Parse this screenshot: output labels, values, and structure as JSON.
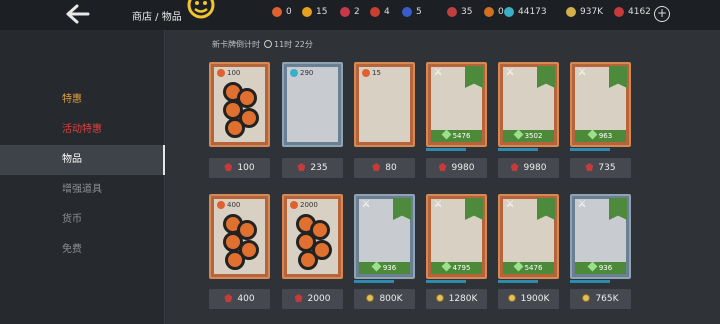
{
  "header": {
    "breadcrumb": "商店 / 物品"
  },
  "resources": [
    {
      "value": "0",
      "color": "#e06030"
    },
    {
      "value": "15",
      "color": "#e8a020"
    },
    {
      "value": "2",
      "color": "#c83848"
    },
    {
      "value": "4",
      "color": "#c84030"
    },
    {
      "value": "5",
      "color": "#3a5cc8"
    },
    {
      "value": "35",
      "color": "#c04040"
    },
    {
      "value": "0",
      "color": "#d07020"
    },
    {
      "value": "44173",
      "color": "#3ab0c8"
    },
    {
      "value": "937K",
      "color": "#d4b04a"
    },
    {
      "value": "4162",
      "color": "#c53a3a"
    }
  ],
  "sidebar": {
    "items": [
      "特惠",
      "活动特惠",
      "物品",
      "增强道具",
      "货币",
      "免费"
    ],
    "colors": [
      "#e0a040",
      "#e04040",
      "#ffffff",
      "#8c8f93",
      "#8c8f93",
      "#8c8f93"
    ]
  },
  "timer": {
    "label": "新卡牌倒计时",
    "value": "11时 22分"
  },
  "row1": [
    {
      "count": "100",
      "price": "100",
      "currency": "ruby",
      "type": "orange"
    },
    {
      "count": "290",
      "price": "235",
      "currency": "ruby",
      "type": "blue"
    },
    {
      "count": "15",
      "price": "80",
      "currency": "ruby",
      "type": "orange"
    },
    {
      "band": "5476",
      "price": "9980",
      "currency": "ruby",
      "type": "orange",
      "flag": "X97"
    },
    {
      "band": "3502",
      "price": "9980",
      "currency": "ruby",
      "type": "orange",
      "flag": "X65"
    },
    {
      "band": "963",
      "price": "735",
      "currency": "ruby",
      "type": "orange",
      "flag": "X13"
    }
  ],
  "row2": [
    {
      "count": "400",
      "price": "400",
      "currency": "ruby",
      "type": "orange"
    },
    {
      "count": "2000",
      "price": "2000",
      "currency": "ruby",
      "type": "orange"
    },
    {
      "band": "936",
      "price": "800K",
      "currency": "coin",
      "type": "blue",
      "flag": "X60"
    },
    {
      "band": "4795",
      "price": "1280K",
      "currency": "coin",
      "type": "orange",
      "flag": "X55"
    },
    {
      "band": "5476",
      "price": "1900K",
      "currency": "coin",
      "type": "orange",
      "flag": "X72"
    },
    {
      "band": "936",
      "price": "765K",
      "currency": "coin",
      "type": "blue",
      "flag": "X72"
    }
  ]
}
